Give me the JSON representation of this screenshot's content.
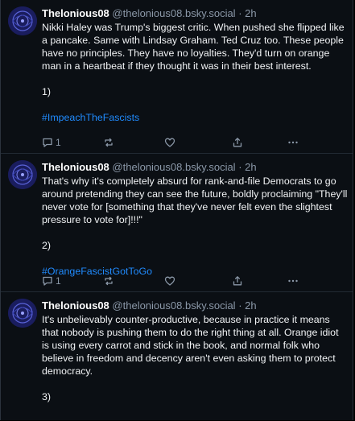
{
  "posts": [
    {
      "author": "Thelonious08",
      "handle": "@thelonious08.bsky.social",
      "separator": "·",
      "time": "2h",
      "lines": [
        "Nikki Haley was Trump's biggest critic. When pushed she flipped like a pancake. Same with Lindsay Graham. Ted Cruz too. These people have no principles. They have no loyalties. They'd turn on orange man in a heartbeat if they thought it was in their best interest.",
        "1)"
      ],
      "hashtag": "#ImpeachTheFascists",
      "reply_count": "1"
    },
    {
      "author": "Thelonious08",
      "handle": "@thelonious08.bsky.social",
      "separator": "·",
      "time": "2h",
      "lines": [
        "That's why it's completely absurd for rank-and-file Democrats to go around pretending they can see the future, boldly proclaiming \"They'll never vote for [something that they've never felt even the slightest pressure to vote for]!!!\"",
        "2)"
      ],
      "hashtag": "#OrangeFascistGotToGo",
      "reply_count": "1"
    },
    {
      "author": "Thelonious08",
      "handle": "@thelonious08.bsky.social",
      "separator": "·",
      "time": "2h",
      "lines": [
        "It's unbelievably counter-productive, because in practice it means that nobody is pushing them to do the right thing at all. Orange idiot is using every carrot and stick in the book, and normal folk who believe in freedom and decency aren't even asking them to protect democracy.",
        "3)"
      ]
    }
  ],
  "icons": {
    "reply": "speech-bubble-icon",
    "repost": "repost-arrows-icon",
    "like": "heart-icon",
    "share": "share-icon",
    "more": "ellipsis-icon"
  },
  "colors": {
    "background": "#0b0f14",
    "text": "#f1f3f5",
    "muted": "#8b98a8",
    "link": "#208bfe",
    "avatar_bg": "#1a1d5e"
  }
}
